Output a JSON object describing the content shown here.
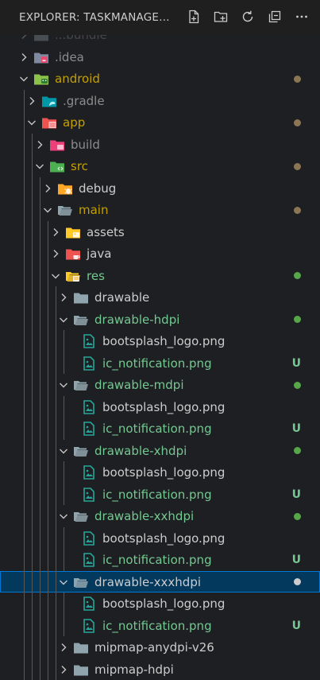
{
  "colors": {
    "background": "#1e1f22",
    "header_bg": "#1f1f1f",
    "modified": "#c4a000",
    "added": "#73c991",
    "modified_dot": "#8a7654",
    "added_dot": "#57a64a",
    "ignored": "#8c8c8c",
    "selected_bg": "#04395e",
    "selected_border": "#0078d4"
  },
  "header": {
    "title": "EXPLORER: TASKMANAGEMEN...",
    "actions": [
      {
        "name": "new-file-icon",
        "label": "New File"
      },
      {
        "name": "new-folder-icon",
        "label": "New Folder"
      },
      {
        "name": "refresh-icon",
        "label": "Refresh Explorer"
      },
      {
        "name": "collapse-all-icon",
        "label": "Collapse Folders"
      },
      {
        "name": "more-actions-icon",
        "label": "More Actions"
      }
    ]
  },
  "tree": [
    {
      "label": "...bundle",
      "depth": 1,
      "type": "folder",
      "expanded": false,
      "icon": "folder-gray",
      "color": "ignored",
      "partial": true
    },
    {
      "label": ".idea",
      "depth": 1,
      "type": "folder",
      "expanded": false,
      "icon": "folder-idea",
      "color": "ignored"
    },
    {
      "label": "android",
      "depth": 1,
      "type": "folder",
      "expanded": true,
      "icon": "folder-android",
      "color": "modified",
      "status": "dot-modified"
    },
    {
      "label": ".gradle",
      "depth": 2,
      "type": "folder",
      "expanded": false,
      "icon": "folder-gradle",
      "color": "ignored"
    },
    {
      "label": "app",
      "depth": 2,
      "type": "folder",
      "expanded": true,
      "icon": "folder-app",
      "color": "modified",
      "status": "dot-modified"
    },
    {
      "label": "build",
      "depth": 3,
      "type": "folder",
      "expanded": false,
      "icon": "folder-build",
      "color": "ignored"
    },
    {
      "label": "src",
      "depth": 3,
      "type": "folder",
      "expanded": true,
      "icon": "folder-src",
      "color": "modified",
      "status": "dot-modified"
    },
    {
      "label": "debug",
      "depth": 4,
      "type": "folder",
      "expanded": false,
      "icon": "folder-debug",
      "color": "normal"
    },
    {
      "label": "main",
      "depth": 4,
      "type": "folder",
      "expanded": true,
      "icon": "folder-open",
      "color": "modified",
      "status": "dot-modified"
    },
    {
      "label": "assets",
      "depth": 5,
      "type": "folder",
      "expanded": false,
      "icon": "folder-assets",
      "color": "normal"
    },
    {
      "label": "java",
      "depth": 5,
      "type": "folder",
      "expanded": false,
      "icon": "folder-java",
      "color": "normal"
    },
    {
      "label": "res",
      "depth": 5,
      "type": "folder",
      "expanded": true,
      "icon": "folder-res",
      "color": "added",
      "status": "dot-added"
    },
    {
      "label": "drawable",
      "depth": 6,
      "type": "folder",
      "expanded": false,
      "icon": "folder-gray",
      "color": "normal"
    },
    {
      "label": "drawable-hdpi",
      "depth": 6,
      "type": "folder",
      "expanded": true,
      "icon": "folder-open",
      "color": "added",
      "status": "dot-added"
    },
    {
      "label": "bootsplash_logo.png",
      "depth": 7,
      "type": "file",
      "icon": "image-file",
      "color": "normal"
    },
    {
      "label": "ic_notification.png",
      "depth": 7,
      "type": "file",
      "icon": "image-file",
      "color": "added",
      "status": "U"
    },
    {
      "label": "drawable-mdpi",
      "depth": 6,
      "type": "folder",
      "expanded": true,
      "icon": "folder-open",
      "color": "added",
      "status": "dot-added"
    },
    {
      "label": "bootsplash_logo.png",
      "depth": 7,
      "type": "file",
      "icon": "image-file",
      "color": "normal"
    },
    {
      "label": "ic_notification.png",
      "depth": 7,
      "type": "file",
      "icon": "image-file",
      "color": "added",
      "status": "U"
    },
    {
      "label": "drawable-xhdpi",
      "depth": 6,
      "type": "folder",
      "expanded": true,
      "icon": "folder-open",
      "color": "added",
      "status": "dot-added"
    },
    {
      "label": "bootsplash_logo.png",
      "depth": 7,
      "type": "file",
      "icon": "image-file",
      "color": "normal"
    },
    {
      "label": "ic_notification.png",
      "depth": 7,
      "type": "file",
      "icon": "image-file",
      "color": "added",
      "status": "U"
    },
    {
      "label": "drawable-xxhdpi",
      "depth": 6,
      "type": "folder",
      "expanded": true,
      "icon": "folder-open",
      "color": "added",
      "status": "dot-added"
    },
    {
      "label": "bootsplash_logo.png",
      "depth": 7,
      "type": "file",
      "icon": "image-file",
      "color": "normal"
    },
    {
      "label": "ic_notification.png",
      "depth": 7,
      "type": "file",
      "icon": "image-file",
      "color": "added",
      "status": "U"
    },
    {
      "label": "drawable-xxxhdpi",
      "depth": 6,
      "type": "folder",
      "expanded": true,
      "icon": "folder-open",
      "color": "normal",
      "status": "dot-selected",
      "selected": true
    },
    {
      "label": "bootsplash_logo.png",
      "depth": 7,
      "type": "file",
      "icon": "image-file",
      "color": "normal"
    },
    {
      "label": "ic_notification.png",
      "depth": 7,
      "type": "file",
      "icon": "image-file",
      "color": "added",
      "status": "U"
    },
    {
      "label": "mipmap-anydpi-v26",
      "depth": 6,
      "type": "folder",
      "expanded": false,
      "icon": "folder-gray",
      "color": "normal"
    },
    {
      "label": "mipmap-hdpi",
      "depth": 6,
      "type": "folder",
      "expanded": false,
      "icon": "folder-gray",
      "color": "normal"
    }
  ]
}
